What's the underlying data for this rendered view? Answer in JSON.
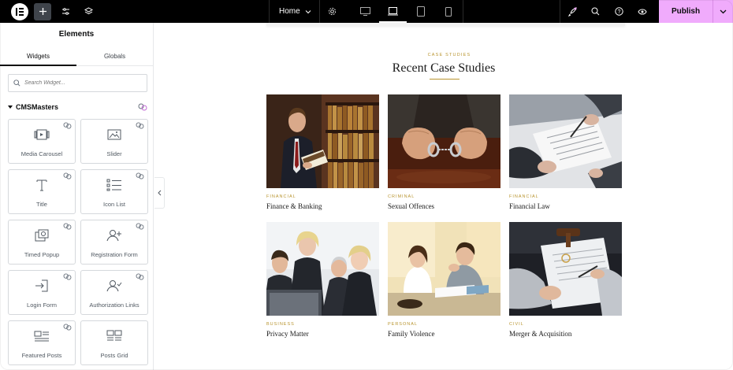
{
  "topbar": {
    "page_name": "Home",
    "publish_label": "Publish",
    "buttons": [
      "elementor-logo",
      "add-element",
      "site-settings",
      "structure"
    ],
    "devices": [
      "desktop",
      "tablet",
      "mobile-landscape",
      "mobile-portrait"
    ],
    "active_device": "desktop",
    "right_icons": [
      "whats-new",
      "search",
      "help",
      "preview"
    ]
  },
  "panel": {
    "title": "Elements",
    "tabs": [
      {
        "label": "Widgets",
        "active": true
      },
      {
        "label": "Globals",
        "active": false
      }
    ],
    "search_placeholder": "Search Widget...",
    "section_label": "CMSMasters",
    "widgets": [
      {
        "label": "Media Carousel",
        "icon": "media-carousel-icon"
      },
      {
        "label": "Slider",
        "icon": "slider-icon"
      },
      {
        "label": "Title",
        "icon": "title-icon"
      },
      {
        "label": "Icon List",
        "icon": "icon-list-icon"
      },
      {
        "label": "Timed Popup",
        "icon": "timed-popup-icon"
      },
      {
        "label": "Registration Form",
        "icon": "registration-form-icon"
      },
      {
        "label": "Login Form",
        "icon": "login-form-icon"
      },
      {
        "label": "Authorization Links",
        "icon": "authorization-links-icon"
      },
      {
        "label": "Featured Posts",
        "icon": "featured-posts-icon"
      },
      {
        "label": "Posts Grid",
        "icon": "posts-grid-icon"
      }
    ]
  },
  "canvas": {
    "eyebrow": "CASE STUDIES",
    "heading": "Recent Case Studies",
    "cases": [
      {
        "category": "FINANCIAL",
        "title": "Finance & Banking"
      },
      {
        "category": "CRIMINAL",
        "title": "Sexual Offences"
      },
      {
        "category": "FINANCIAL",
        "title": "Financial Law"
      },
      {
        "category": "BUSINESS",
        "title": "Privacy Matter"
      },
      {
        "category": "PERSONAL",
        "title": "Family Violence"
      },
      {
        "category": "CIVIL",
        "title": "Merger & Acquisition"
      }
    ]
  },
  "colors": {
    "topbar_bg": "#000000",
    "publish_bg": "#f0abfc",
    "accent_gold": "#b8942f",
    "pro_badge": "#c36bd6"
  }
}
